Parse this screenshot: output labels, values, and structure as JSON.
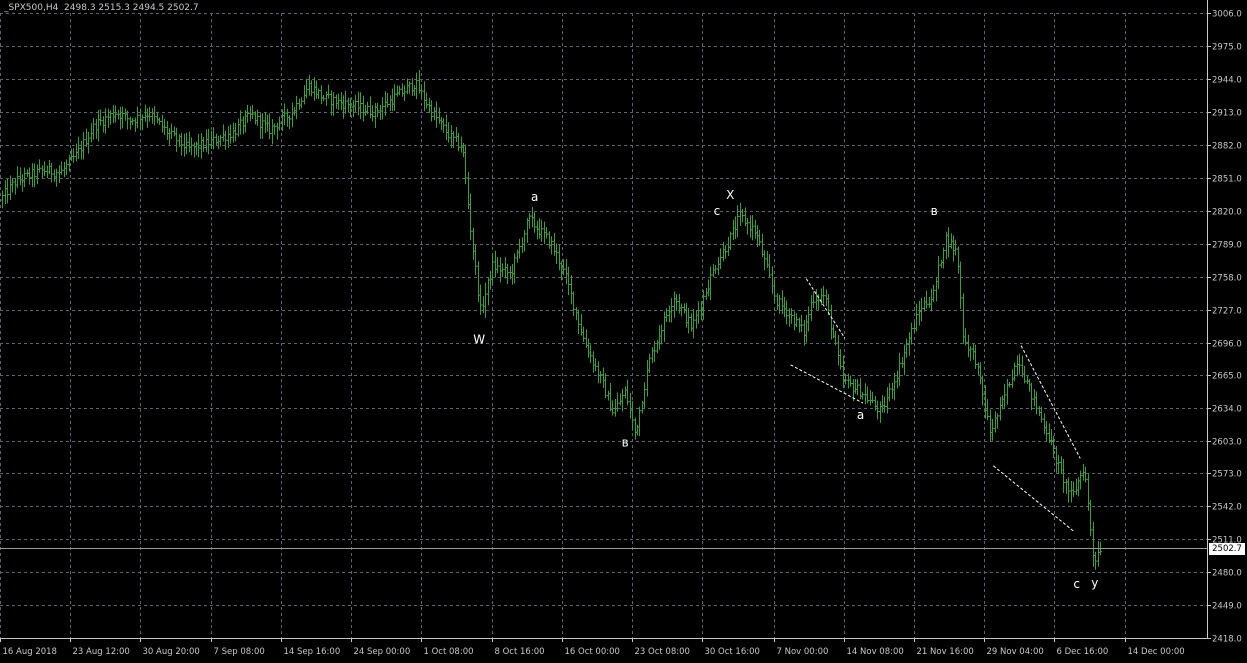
{
  "window": {
    "symbol_info": "_SPX500,H4  2498.3 2515.3 2494.5 2502.7"
  },
  "colors": {
    "background": "#000000",
    "grid": "#5a6370",
    "candle": "#3f9a3f",
    "text": "#c8c8c8",
    "wave_label": "#ffffff",
    "bid_line": "#9a9a9a",
    "price_tag_bg": "#ffffff"
  },
  "chart_data": {
    "type": "line",
    "style": "ohlc-bars",
    "symbol": "_SPX500",
    "timeframe": "H4",
    "last": {
      "open": 2498.3,
      "high": 2515.3,
      "low": 2494.5,
      "close": 2502.7
    },
    "current_price": 2502.7,
    "current_price_label": "2502.7",
    "ylim": [
      2418.0,
      3006.0
    ],
    "y_ticks": [
      "3006.0",
      "2975.0",
      "2944.0",
      "2913.0",
      "2882.0",
      "2851.0",
      "2820.0",
      "2789.0",
      "2758.0",
      "2727.0",
      "2696.0",
      "2665.0",
      "2634.0",
      "2603.0",
      "2573.0",
      "2542.0",
      "2511.0",
      "2480.0",
      "2449.0",
      "2418.0"
    ],
    "y_tick_values": [
      3006,
      2975,
      2944,
      2913,
      2882,
      2851,
      2820,
      2789,
      2758,
      2727,
      2696,
      2665,
      2634,
      2603,
      2573,
      2542,
      2511,
      2480,
      2449,
      2418
    ],
    "x_ticks": [
      "16 Aug 2018",
      "23 Aug 12:00",
      "30 Aug 20:00",
      "7 Sep 08:00",
      "14 Sep 16:00",
      "24 Sep 00:00",
      "1 Oct 08:00",
      "8 Oct 16:00",
      "16 Oct 00:00",
      "23 Oct 08:00",
      "30 Oct 16:00",
      "7 Nov 00:00",
      "14 Nov 08:00",
      "21 Nov 16:00",
      "29 Nov 04:00",
      "6 Dec 16:00",
      "14 Dec 00:00"
    ],
    "grid": true,
    "x_range": [
      0,
      100
    ],
    "x_tick_positions": [
      0,
      5.8,
      11.6,
      17.5,
      23.3,
      29.1,
      34.9,
      40.8,
      46.6,
      52.4,
      58.2,
      64.1,
      69.9,
      75.7,
      81.5,
      87.3,
      93.2
    ],
    "path_keypoints": [
      {
        "x": 0.2,
        "y": 2830
      },
      {
        "x": 1.5,
        "y": 2848
      },
      {
        "x": 3.8,
        "y": 2858
      },
      {
        "x": 5.2,
        "y": 2856
      },
      {
        "x": 6.5,
        "y": 2872
      },
      {
        "x": 8.0,
        "y": 2900
      },
      {
        "x": 9.8,
        "y": 2913
      },
      {
        "x": 11.0,
        "y": 2905
      },
      {
        "x": 12.5,
        "y": 2912
      },
      {
        "x": 14.0,
        "y": 2894
      },
      {
        "x": 15.8,
        "y": 2878
      },
      {
        "x": 17.5,
        "y": 2884
      },
      {
        "x": 19.5,
        "y": 2894
      },
      {
        "x": 21.0,
        "y": 2910
      },
      {
        "x": 22.5,
        "y": 2896
      },
      {
        "x": 24.3,
        "y": 2912
      },
      {
        "x": 25.8,
        "y": 2938
      },
      {
        "x": 27.0,
        "y": 2926
      },
      {
        "x": 29.0,
        "y": 2920
      },
      {
        "x": 31.2,
        "y": 2913
      },
      {
        "x": 33.3,
        "y": 2930
      },
      {
        "x": 34.6,
        "y": 2940
      },
      {
        "x": 36.0,
        "y": 2912
      },
      {
        "x": 37.5,
        "y": 2889
      },
      {
        "x": 38.5,
        "y": 2880
      },
      {
        "x": 39.2,
        "y": 2800
      },
      {
        "x": 40.0,
        "y": 2725
      },
      {
        "x": 41.0,
        "y": 2768
      },
      {
        "x": 42.5,
        "y": 2760
      },
      {
        "x": 44.0,
        "y": 2812
      },
      {
        "x": 45.8,
        "y": 2790
      },
      {
        "x": 47.0,
        "y": 2760
      },
      {
        "x": 48.5,
        "y": 2700
      },
      {
        "x": 50.0,
        "y": 2660
      },
      {
        "x": 51.0,
        "y": 2630
      },
      {
        "x": 52.0,
        "y": 2650
      },
      {
        "x": 52.8,
        "y": 2610
      },
      {
        "x": 54.0,
        "y": 2680
      },
      {
        "x": 56.0,
        "y": 2740
      },
      {
        "x": 57.5,
        "y": 2710
      },
      {
        "x": 59.5,
        "y": 2770
      },
      {
        "x": 60.5,
        "y": 2790
      },
      {
        "x": 61.5,
        "y": 2815
      },
      {
        "x": 62.8,
        "y": 2800
      },
      {
        "x": 64.5,
        "y": 2735
      },
      {
        "x": 65.5,
        "y": 2724
      },
      {
        "x": 66.8,
        "y": 2705
      },
      {
        "x": 67.5,
        "y": 2738
      },
      {
        "x": 68.5,
        "y": 2740
      },
      {
        "x": 70.0,
        "y": 2660
      },
      {
        "x": 71.5,
        "y": 2650
      },
      {
        "x": 73.2,
        "y": 2630
      },
      {
        "x": 74.5,
        "y": 2667
      },
      {
        "x": 75.5,
        "y": 2700
      },
      {
        "x": 76.5,
        "y": 2730
      },
      {
        "x": 77.5,
        "y": 2740
      },
      {
        "x": 78.5,
        "y": 2795
      },
      {
        "x": 79.5,
        "y": 2780
      },
      {
        "x": 80.0,
        "y": 2700
      },
      {
        "x": 81.0,
        "y": 2680
      },
      {
        "x": 82.2,
        "y": 2612
      },
      {
        "x": 83.0,
        "y": 2632
      },
      {
        "x": 84.5,
        "y": 2682
      },
      {
        "x": 85.5,
        "y": 2650
      },
      {
        "x": 87.0,
        "y": 2610
      },
      {
        "x": 88.0,
        "y": 2575
      },
      {
        "x": 89.0,
        "y": 2550
      },
      {
        "x": 90.0,
        "y": 2580
      },
      {
        "x": 90.8,
        "y": 2490
      },
      {
        "x": 91.3,
        "y": 2503
      }
    ],
    "annotations": [
      {
        "text": "W",
        "x": 39.7,
        "y": 2695
      },
      {
        "text": "a",
        "x": 44.3,
        "y": 2829
      },
      {
        "text": "в",
        "x": 51.8,
        "y": 2598
      },
      {
        "text": "c",
        "x": 59.4,
        "y": 2816
      },
      {
        "text": "X",
        "x": 60.5,
        "y": 2831
      },
      {
        "text": "a",
        "x": 71.3,
        "y": 2624
      },
      {
        "text": "в",
        "x": 77.4,
        "y": 2816
      },
      {
        "text": "c",
        "x": 89.2,
        "y": 2465
      },
      {
        "text": "y",
        "x": 90.7,
        "y": 2466
      }
    ],
    "trendlines": [
      {
        "from": {
          "x": 66.8,
          "y": 2756
        },
        "to": {
          "x": 70.0,
          "y": 2700
        }
      },
      {
        "from": {
          "x": 65.5,
          "y": 2675
        },
        "to": {
          "x": 71.5,
          "y": 2639
        }
      },
      {
        "from": {
          "x": 84.6,
          "y": 2693
        },
        "to": {
          "x": 89.5,
          "y": 2587
        }
      },
      {
        "from": {
          "x": 82.3,
          "y": 2580
        },
        "to": {
          "x": 89.0,
          "y": 2518
        }
      }
    ]
  }
}
